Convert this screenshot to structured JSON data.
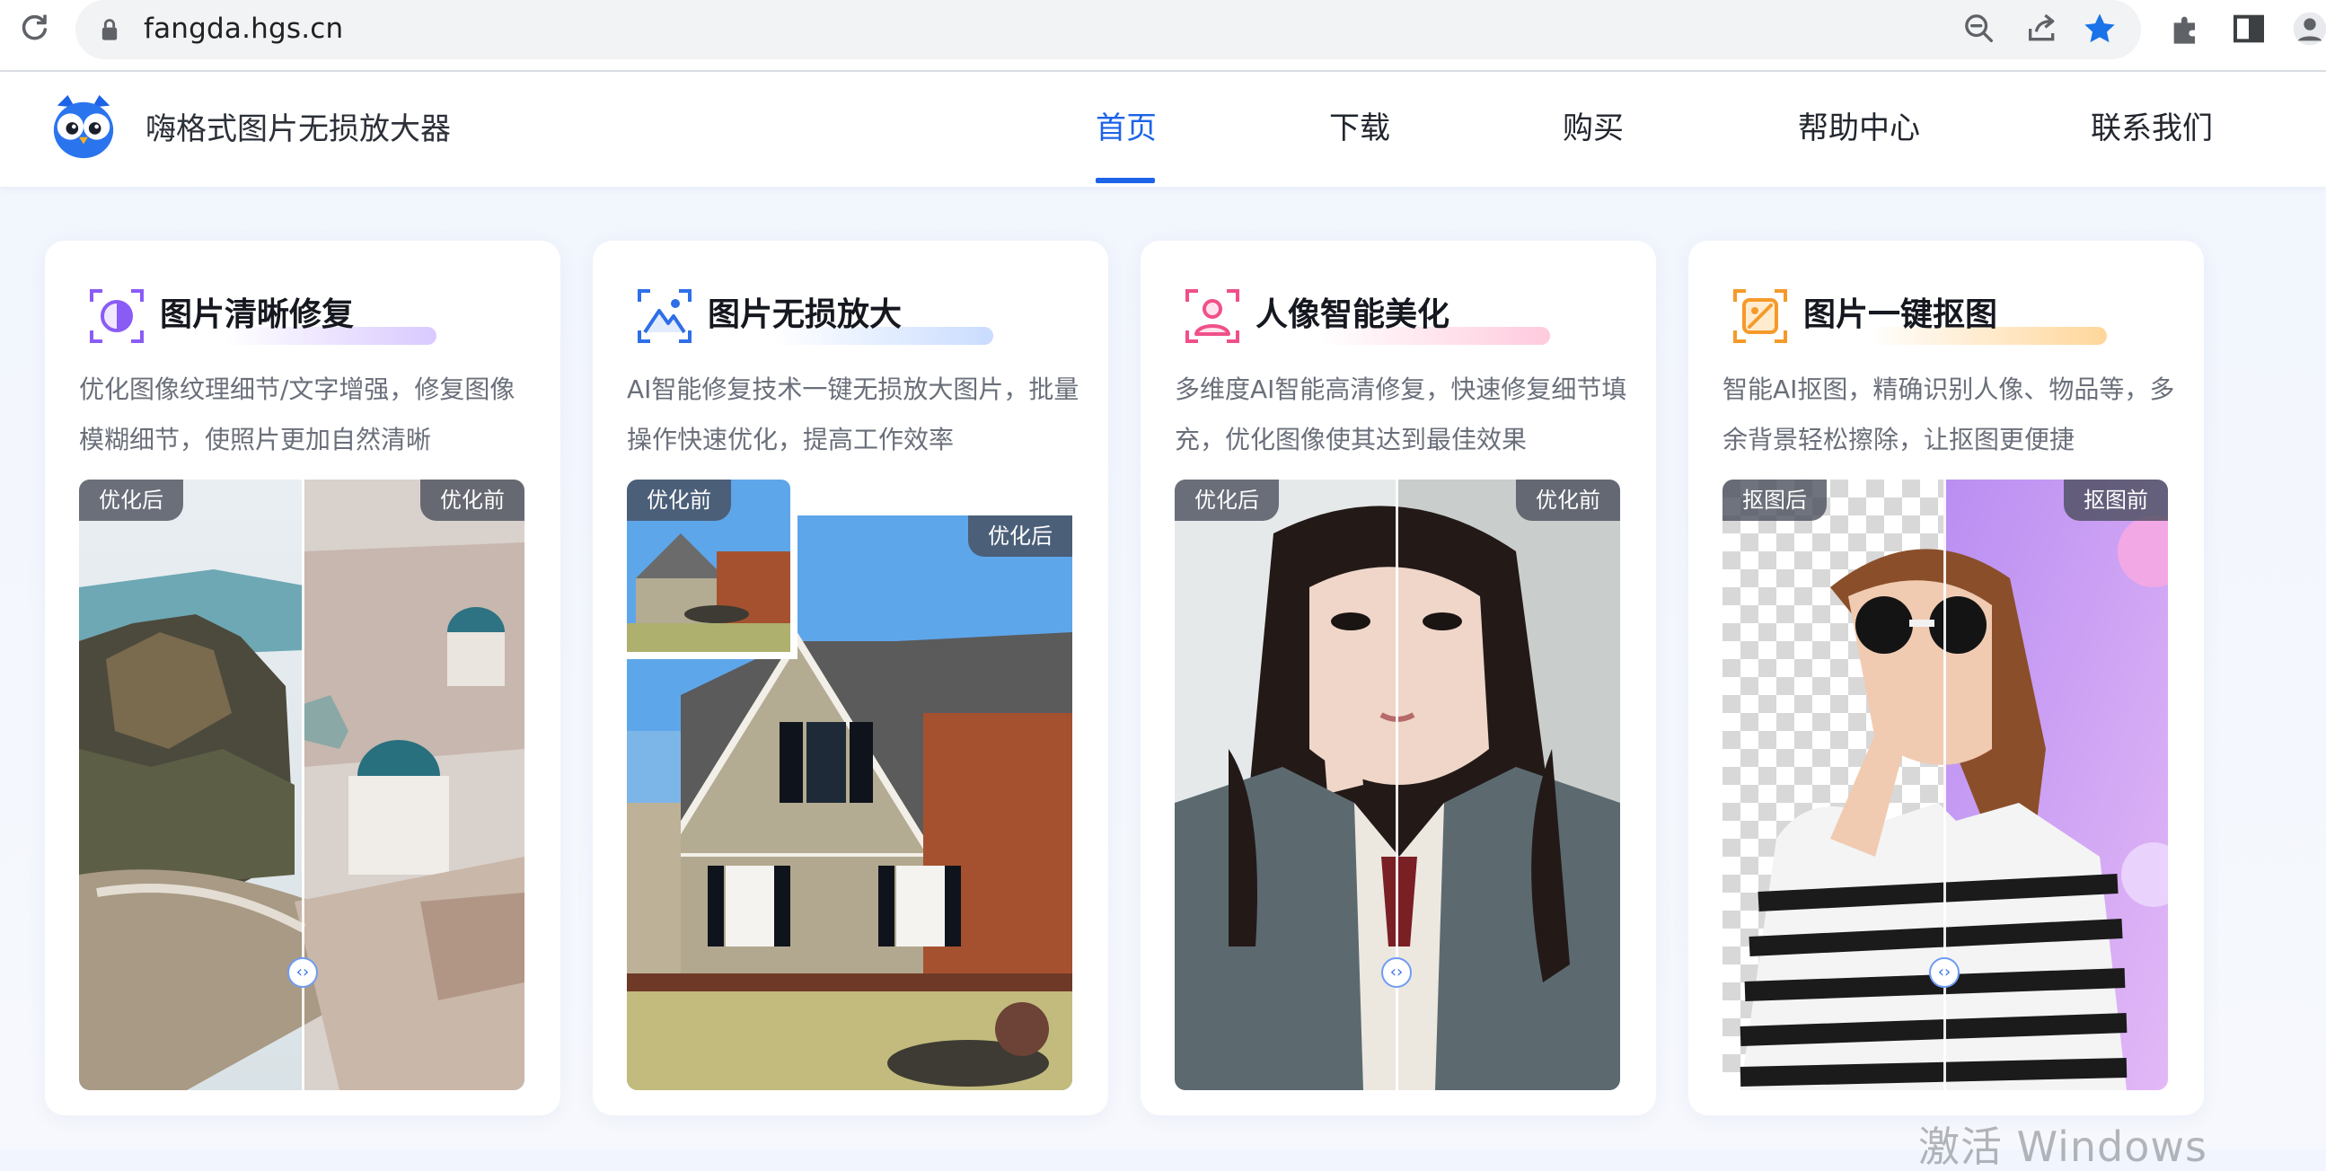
{
  "browser": {
    "url": "fangda.hgs.cn",
    "icons": [
      "reload-icon",
      "lock-icon",
      "zoom-icon",
      "share-icon",
      "bookmark-star-icon",
      "extensions-icon",
      "side-panel-icon",
      "profile-icon"
    ]
  },
  "site": {
    "name": "嗨格式图片无损放大器",
    "logo": "owl-logo"
  },
  "nav": {
    "items": [
      "首页",
      "下载",
      "购买",
      "帮助中心",
      "联系我们"
    ],
    "active_index": 0,
    "accent_color": "#1d63e8"
  },
  "cards": [
    {
      "title": "图片清晰修复",
      "desc": "优化图像纹理细节/文字增强，修复图像模糊细节，使照片更加自然清晰",
      "badge_left": "优化后",
      "badge_right": "优化前",
      "icon": "contrast-circle-icon",
      "accent": "#8a5cf6"
    },
    {
      "title": "图片无损放大",
      "desc": "AI智能修复技术一键无损放大图片，批量操作快速优化，提高工作效率",
      "badge_left": "优化前",
      "badge_right": "优化后",
      "icon": "mountain-image-icon",
      "accent": "#2e6fe8"
    },
    {
      "title": "人像智能美化",
      "desc": "多维度AI智能高清修复，快速修复细节填充，优化图像使其达到最佳效果",
      "badge_left": "优化后",
      "badge_right": "优化前",
      "icon": "portrait-icon",
      "accent": "#f0508a"
    },
    {
      "title": "图片一键抠图",
      "desc": "智能AI抠图，精确识别人像、物品等，多余背景轻松擦除，让抠图更便捷",
      "badge_left": "抠图后",
      "badge_right": "抠图前",
      "icon": "cutout-icon",
      "accent": "#f59a2a"
    }
  ],
  "watermark": "激活 Windows"
}
